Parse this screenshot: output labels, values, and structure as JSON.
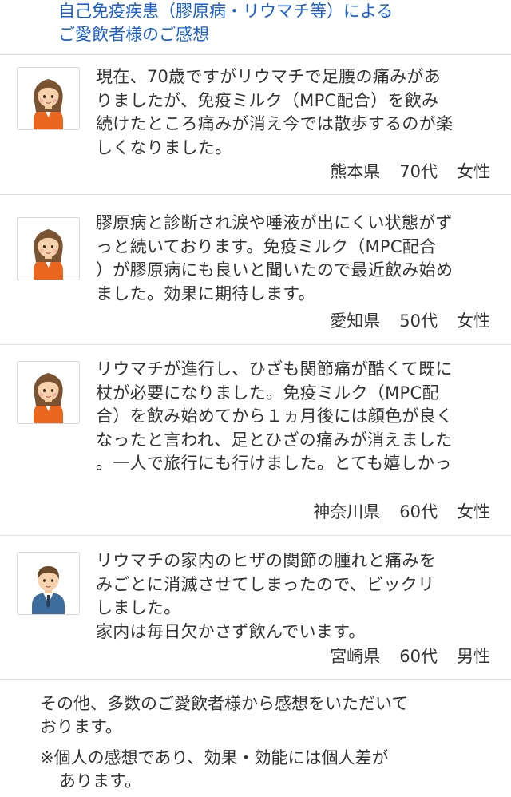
{
  "header": {
    "title_lines": [
      "自己免疫疾患（膠原病・リウマチ等）による",
      "ご愛飲者様のご感想"
    ]
  },
  "testimonials": [
    {
      "avatar_icon": "woman-avatar-icon",
      "lines": [
        "現在、70歳ですがリウマチで足腰の痛みがあ",
        "りましたが、免疫ミルク（MPC配合）を飲み",
        "続けたところ痛みが消え今では散歩するのが楽",
        "しくなりました。"
      ],
      "prefecture": "熊本県",
      "age": "70代",
      "gender": "女性"
    },
    {
      "avatar_icon": "woman-avatar-icon",
      "lines": [
        "膠原病と診断され涙や唾液が出にくい状態がず",
        "っと続いております。免疫ミルク（MPC配合",
        "）が膠原病にも良いと聞いたので最近飲み始め",
        "ました。効果に期待します。"
      ],
      "prefecture": "愛知県",
      "age": "50代",
      "gender": "女性"
    },
    {
      "avatar_icon": "woman-avatar-icon",
      "lines": [
        "リウマチが進行し、ひざも関節痛が酷くて既に",
        "杖が必要になりました。免疫ミルク（MPC配",
        "合）を飲み始めてから１ヵ月後には顔色が良く",
        "なったと言われ、足とひざの痛みが消えました",
        "。一人で旅行にも行けました。とても嬉しかっ"
      ],
      "prefecture": "神奈川県",
      "age": "60代",
      "gender": "女性"
    },
    {
      "avatar_icon": "man-avatar-icon",
      "lines": [
        "リウマチの家内のヒザの関節の腫れと痛みを",
        "みごとに消滅させてしまったので、ビックリ",
        "しました。",
        "家内は毎日欠かさず飲んでいます。"
      ],
      "prefecture": "宮崎県",
      "age": "60代",
      "gender": "男性"
    }
  ],
  "footer": {
    "note_lines": [
      "その他、多数のご愛飲者様から感想をいただいて",
      "おります。"
    ],
    "disclaimer_lines": [
      "※個人の感想であり、効果・効能には個人差が",
      "あります。"
    ]
  },
  "colors": {
    "title": "#1a5fd0",
    "text": "#333333",
    "divider": "#e0e0e0",
    "woman_outfit": "#e8661e",
    "man_suit": "#3d6d9c"
  }
}
